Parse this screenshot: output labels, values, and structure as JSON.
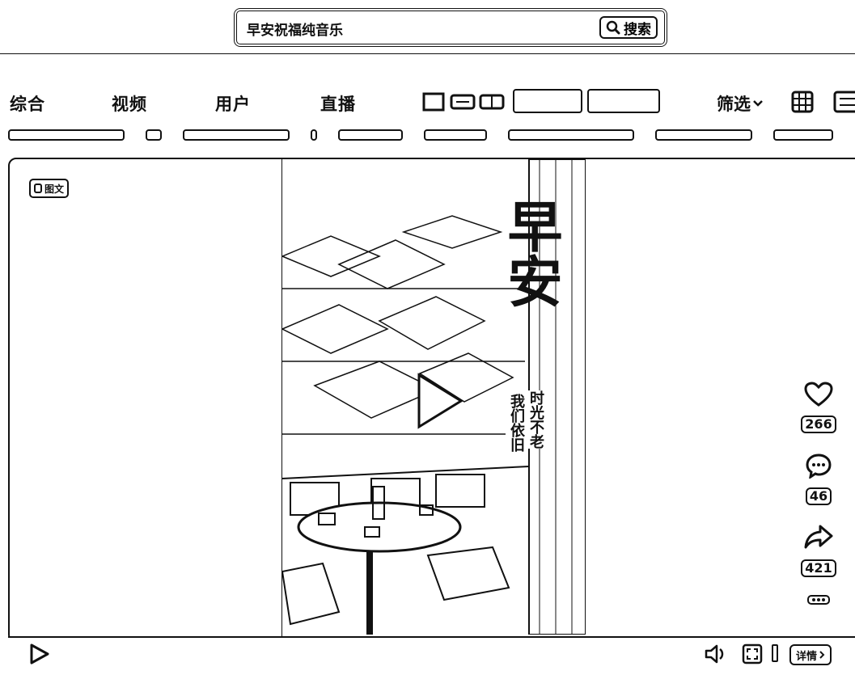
{
  "search": {
    "query": "早安祝福纯音乐",
    "button_label": "搜索"
  },
  "tabs": [
    {
      "label": "综合"
    },
    {
      "label": "视频"
    },
    {
      "label": "用户"
    },
    {
      "label": "直播"
    }
  ],
  "filter": {
    "label": "筛选"
  },
  "post": {
    "type_badge": "图文",
    "poster_title": "早安",
    "poster_subtitle_1": "时光不老",
    "poster_subtitle_2": "我们依旧",
    "likes": "266",
    "comments": "46",
    "shares": "421"
  },
  "bottom_bar": {
    "detail_label": "详情"
  },
  "icons": {
    "search": "search-icon",
    "filter": "chevron-down-icon",
    "grid_view": "grid-icon",
    "list_view": "list-icon",
    "like": "heart-icon",
    "comment": "comment-icon",
    "share": "share-icon",
    "more": "more-icon",
    "play": "play-icon",
    "volume": "volume-icon",
    "fullscreen": "fullscreen-icon"
  }
}
